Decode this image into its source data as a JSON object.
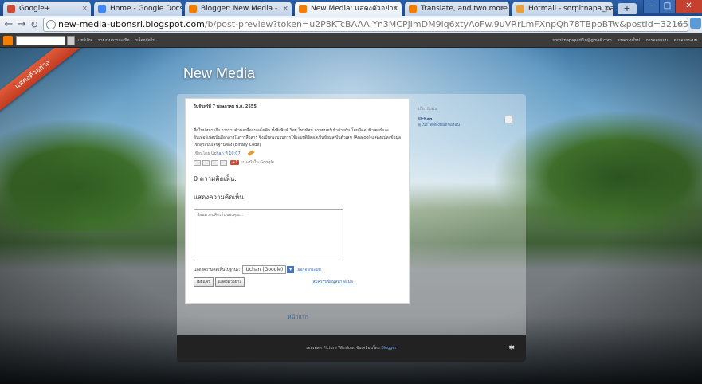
{
  "tabs": [
    {
      "label": "Google+",
      "fav": "#d14836",
      "active": false
    },
    {
      "label": "Home - Google Docs",
      "fav": "#4285f4",
      "active": false
    },
    {
      "label": "Blogger: New Media - ",
      "fav": "#f57d00",
      "active": false
    },
    {
      "label": "New Media: แสดงตัวอย่าง",
      "fav": "#f57d00",
      "active": true
    },
    {
      "label": "Translate, and two more",
      "fav": "#f57d00",
      "active": false
    },
    {
      "label": "Hotmail - sorpitnapa_part",
      "fav": "#e8a13a",
      "active": false
    }
  ],
  "toolbar": {
    "host": "new-media-ubonsri.blogspot.com",
    "path": "/b/post-preview?token=u2P8KTcBAAA.Yn3MCPjImDM9lq6xtyAoFw.9uVRrLmFXnpQh78TBpoBTw&postId=32165873716993607908&type=POS"
  },
  "blogger_bar": {
    "links": [
      "แชร์เกิน",
      "รายงานการละเมิด",
      "บล็อกถัดไป"
    ],
    "right": [
      "sorpitnapapart1o@gmail.com",
      "บทความใหม่",
      "การออกแบบ",
      "ออกจากระบบ"
    ]
  },
  "ribbon": "แสดงตัวอย่าง",
  "blog": {
    "title": "New Media",
    "post_date": "วันจันทร์ที่ 7 พฤษภาคม พ.ศ. 2555",
    "body": "สื่อใหม่หมายถึง การรวมตัวของสื่อแบบดั้งเดิม ทั้งสิ่งพิมพ์ วิทยุ โทรทัศน์ ภาพยนตร์เข้าด้วยกัน โดยมีคอมพิวเตอร์และอินเทอร์เน็ตเป็นสื่อกลางในการสื่อสาร ซึ่งเป็นกระบวนการใช้ระบบดิจิตอลเป็นข้อมูลเป็นตัวเลข (Analog) แสดงแปลงข้อมูลเข้าสู่ระบบเลขฐานสอง (Binary Code)",
    "meta_prefix": "เขียนโดย",
    "author": "Uchan",
    "meta_time": "ที่ 10:07",
    "recommend": "แนะนำใน Google",
    "comments_count": "0 ความคิดเห็น:",
    "comment_form": "แสดงความคิดเห็น",
    "comment_placeholder": "ป้อนความคิดเห็นของคุณ...",
    "comment_as": "แสดงความคิดเห็นในฐานะ:",
    "identity": "Uchan (Google)",
    "signout": "ออกจากระบบ",
    "publish": "เผยแพร่",
    "preview": "แสดงตัวอย่าง",
    "subscribe": "สมัครรับข้อมูลทางอีเมล",
    "home": "หน้าแรก"
  },
  "sidebar": {
    "heading": "เกี่ยวกับฉัน",
    "name": "Uchan",
    "profile": "ดูโปรไฟล์ทั้งหมดของฉัน"
  },
  "footer": {
    "text": "เทมเพลต Picture Window. ขับเคลื่อนโดย",
    "brand": "Blogger"
  }
}
